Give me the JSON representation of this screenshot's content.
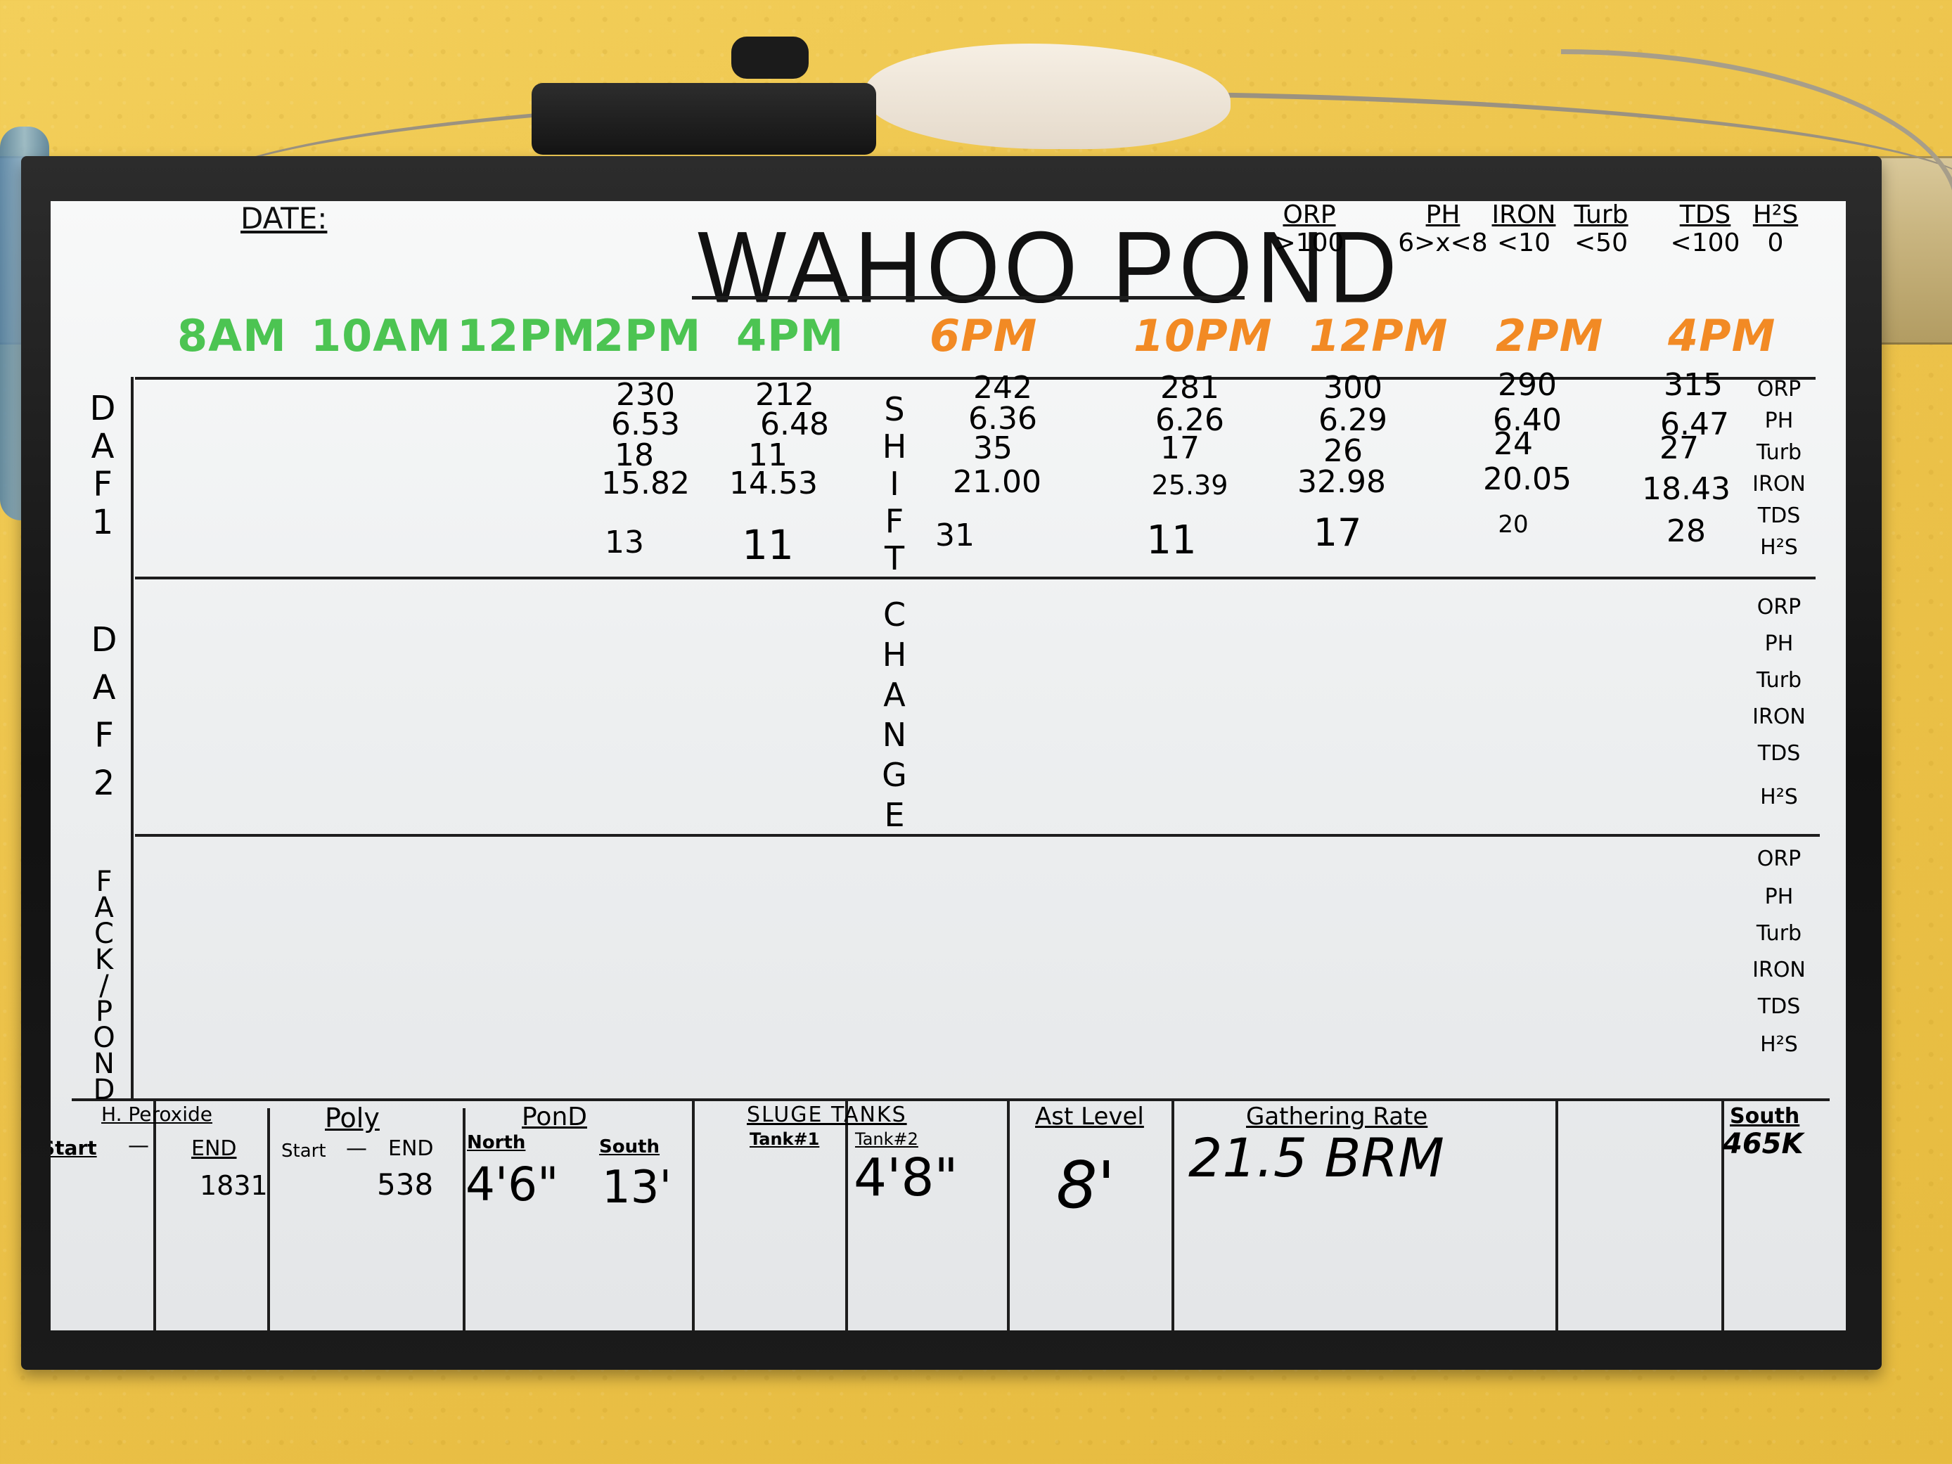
{
  "board": {
    "date_label": "DATE:",
    "title": "WAHOO POND",
    "limits": [
      {
        "key": "ORP",
        "limit": ">100"
      },
      {
        "key": "PH",
        "limit": "6>x<8"
      },
      {
        "key": "IRON",
        "limit": "<10"
      },
      {
        "key": "Turb",
        "limit": "<50"
      },
      {
        "key": "TDS",
        "limit": "<100"
      },
      {
        "key": "H²S",
        "limit": "0"
      }
    ],
    "times_day": [
      "8AM",
      "10AM",
      "12PM",
      "2PM",
      "4PM"
    ],
    "times_night": [
      "6PM",
      "10PM",
      "12PM",
      "2PM",
      "4PM"
    ],
    "rows": [
      {
        "label": [
          "D",
          "A",
          "F",
          "1"
        ],
        "params": [
          "ORP",
          "PH",
          "Turb",
          "IRON",
          "TDS",
          "H²S"
        ]
      },
      {
        "label": [
          "D",
          "A",
          "F",
          "2"
        ],
        "params": [
          "ORP",
          "PH",
          "Turb",
          "IRON",
          "TDS",
          "H²S"
        ]
      },
      {
        "label": [
          "F",
          "A",
          "C",
          "K",
          "/",
          "P",
          "O",
          "N",
          "D"
        ],
        "params": [
          "ORP",
          "PH",
          "Turb",
          "IRON",
          "TDS",
          "H²S"
        ]
      }
    ],
    "shift_change": [
      "S",
      "H",
      "I",
      "F",
      "T",
      "C",
      "H",
      "A",
      "N",
      "G",
      "E"
    ],
    "daf1_readings": [
      {
        "time": "2PM",
        "ORP": "230",
        "PH": "6.53",
        "Turb": "18",
        "IRON": "15.82",
        "H2S": "13"
      },
      {
        "time": "4PM",
        "ORP": "212",
        "PH": "6.48",
        "Turb": "11",
        "IRON": "14.53",
        "H2S": "11"
      },
      {
        "time": "6PM",
        "ORP": "242",
        "PH": "6.36",
        "Turb": "35",
        "IRON": "21.00",
        "H2S": "31"
      },
      {
        "time": "10PM",
        "ORP": "281",
        "PH": "6.26",
        "Turb": "17",
        "IRON": "25.39",
        "H2S": "11"
      },
      {
        "time": "12PM",
        "ORP": "300",
        "PH": "6.29",
        "Turb": "26",
        "IRON": "32.98",
        "H2S": "17"
      },
      {
        "time": "2PM",
        "ORP": "290",
        "PH": "6.40",
        "Turb": "24",
        "IRON": "20.05",
        "H2S": "20"
      },
      {
        "time": "4PM",
        "ORP": "315",
        "PH": "6.47",
        "Turb": "27",
        "IRON": "18.43",
        "H2S": "28"
      }
    ],
    "bottom": {
      "h_peroxide": {
        "title": "H. Peroxide",
        "start": "Start",
        "dash": "—",
        "end": "END",
        "value": "1831"
      },
      "poly": {
        "title": "Poly",
        "start": "Start",
        "dash": "—",
        "end": "END",
        "value": "538"
      },
      "pond": {
        "title": "PonD",
        "north": "North",
        "north_value": "4'6\"",
        "south": "South",
        "south_value": "13'"
      },
      "sludge": {
        "title": "SLUGE TANKS",
        "tank1": "Tank#1",
        "tank2": "Tank#2",
        "tank2_value": "4'8\""
      },
      "ast": {
        "title": "Ast Level",
        "value": "8'"
      },
      "gathering": {
        "title": "Gathering Rate",
        "value": "21.5 BRM"
      },
      "south": {
        "title": "South",
        "value": "465K"
      }
    }
  }
}
